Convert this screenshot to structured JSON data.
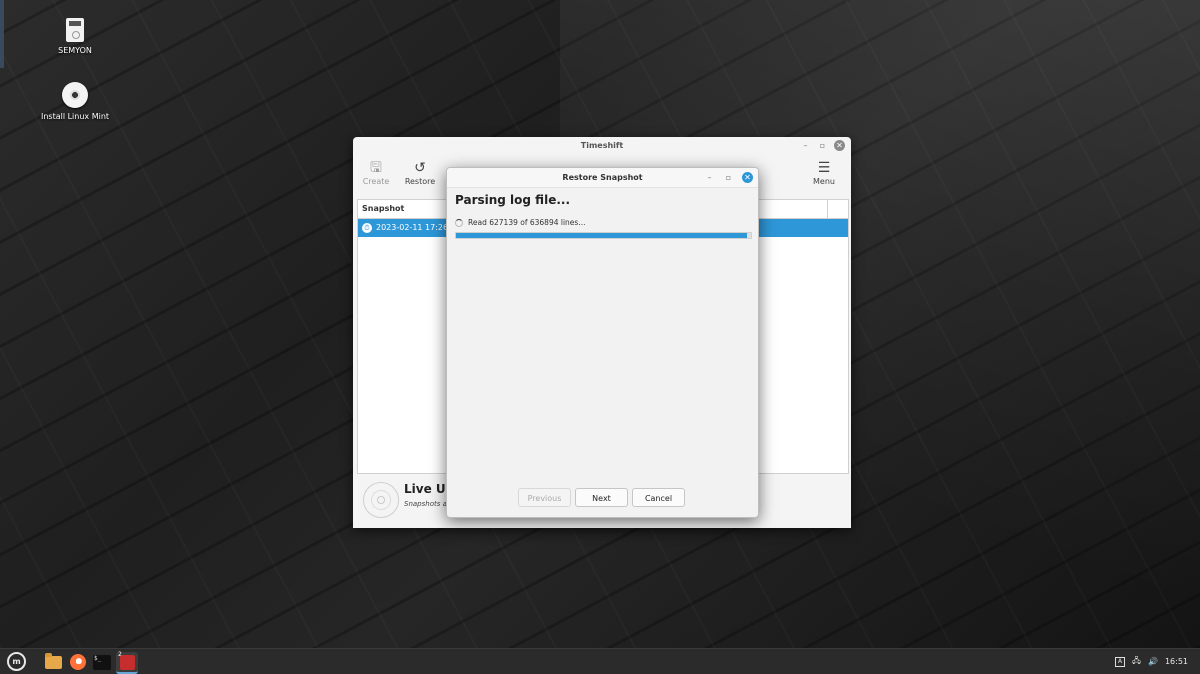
{
  "desktop": {
    "icons": [
      {
        "label": "SEMYON",
        "icon": "usb-drive-icon"
      },
      {
        "label": "Install Linux Mint",
        "icon": "disc-icon"
      }
    ]
  },
  "timeshift": {
    "title": "Timeshift",
    "toolbar": {
      "create_label": "Create",
      "restore_label": "Restore",
      "menu_label": "Menu"
    },
    "list": {
      "column_header": "Snapshot",
      "rows": [
        {
          "date": "2023-02-11 17:26:"
        }
      ]
    },
    "live": {
      "title": "Live US",
      "subtitle": "Snapshots a"
    }
  },
  "restore_dialog": {
    "title": "Restore Snapshot",
    "heading": "Parsing log file...",
    "status": "Read 627139 of 636894 lines...",
    "progress": 0.985,
    "buttons": {
      "previous": "Previous",
      "next": "Next",
      "cancel": "Cancel"
    }
  },
  "taskbar": {
    "workspace_badge": "2",
    "tray_a_label": "A",
    "clock": "16:51"
  },
  "colors": {
    "accent": "#2e97d8"
  }
}
